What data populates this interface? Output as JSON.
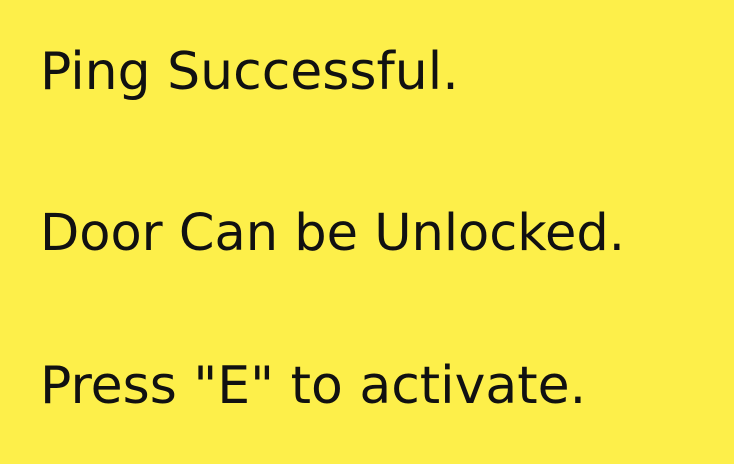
{
  "colors": {
    "background": "#FDEF4A",
    "text": "#111111"
  },
  "prompt": {
    "line1": "Ping Successful.",
    "line2": "Door Can be Unlocked.",
    "line3": "Press \"E\" to activate."
  }
}
